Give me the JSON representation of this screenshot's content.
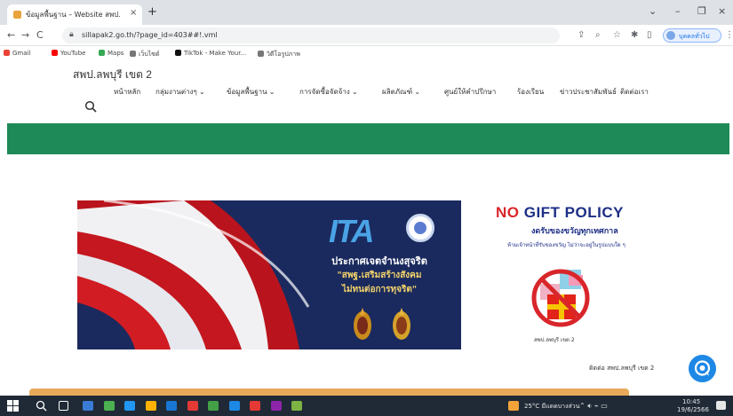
{
  "browser": {
    "tab_title": "ข้อมูลพื้นฐาน – Website สพป.",
    "tab_close": "×",
    "new_tab": "+",
    "window_controls": [
      "⌄",
      "–",
      "❐",
      "×"
    ],
    "nav": [
      "←",
      "→",
      "C"
    ],
    "url": "sillapak2.go.th/?page_id=403##!.vml",
    "profile_label": "บุคคลทั่วไป",
    "bookmarks": [
      {
        "label": "Gmail",
        "color": "#ea4335"
      },
      {
        "label": "YouTube",
        "color": "#ff0000"
      },
      {
        "label": "Maps",
        "color": "#34a853"
      },
      {
        "label": "เว็บไซต์",
        "color": "#555555"
      },
      {
        "label": "TikTok - Make Your...",
        "color": "#111111"
      },
      {
        "label": "วิดีโอรูปภาพ",
        "color": "#555555"
      }
    ]
  },
  "site": {
    "title": "สพป.ลพบุรี เขต 2",
    "menu": [
      "หน้าหลัก",
      "กลุ่มงานต่างๆ ⌄",
      "ข้อมูลพื้นฐาน ⌄",
      "การจัดซื้อจัดจ้าง ⌄",
      "ผลิตภัณฑ์ ⌄",
      "ศูนย์ให้คำปรึกษา",
      "ร้องเรียน",
      "ข่าวประชาสัมพันธ์",
      "ติดต่อเรา"
    ]
  },
  "banner": {
    "logo_text": "ITA",
    "line1": "ประกาศเจตจำนงสุจริต",
    "line2": "\"สพฐ.เสริมสร้างสังคม",
    "line3": "ไม่ทนต่อการทุจริต\""
  },
  "no_gift": {
    "title_no": "NO",
    "title_rest": " GIFT POLICY",
    "subtitle": "งดรับของขวัญทุกเทศกาล",
    "note": "ห้ามเจ้าหน้าที่รับของขวัญ ไม่ว่าจะอยู่ในรูปแบบใด ๆ",
    "caption": "สพป.ลพบุรี เขต 2"
  },
  "footer": {
    "text": "ติดต่อ สพป.ลพบุรี เขต 2"
  },
  "taskbar": {
    "apps": [
      "#3a7bd5",
      "#4caf50",
      "#2196f3",
      "#ffb300",
      "#1976d2",
      "#e53935",
      "#43a047",
      "#1e88e5",
      "#e53935",
      "#8e24aa",
      "#7cb342"
    ],
    "weather": "25°C มีแดดบางส่วน",
    "time": "10:45",
    "date": "19/6/2566"
  }
}
